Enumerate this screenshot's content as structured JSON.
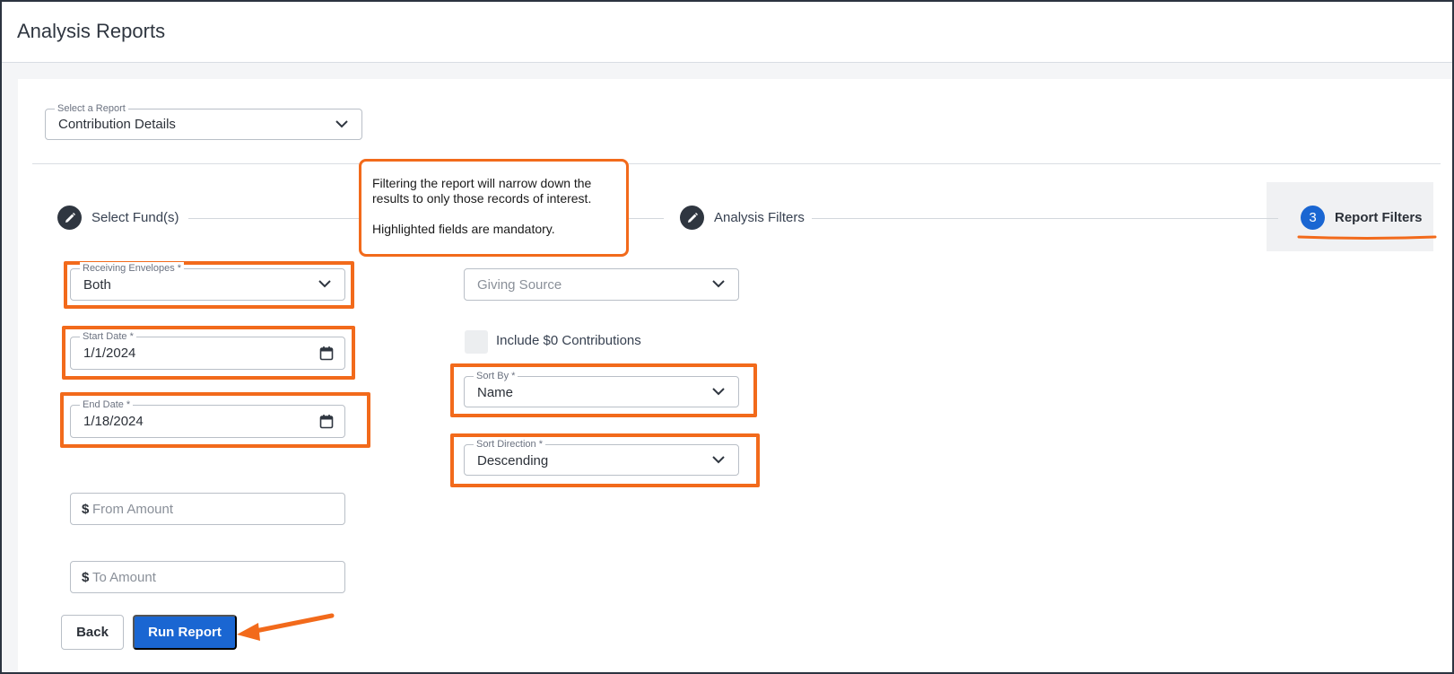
{
  "header": {
    "title": "Analysis Reports"
  },
  "report_select": {
    "label": "Select a Report",
    "value": "Contribution Details"
  },
  "steps": [
    {
      "label": "Select Fund(s)",
      "icon": "pencil-icon"
    },
    {
      "label": "Analysis Filters",
      "icon": "pencil-icon"
    },
    {
      "number": "3",
      "label": "Report Filters"
    }
  ],
  "callout": {
    "line1": "Filtering the report will narrow down the results to only those records of interest.",
    "line2": "Highlighted fields are mandatory."
  },
  "form": {
    "receiving_envelopes": {
      "label": "Receiving Envelopes *",
      "value": "Both"
    },
    "start_date": {
      "label": "Start Date *",
      "value": "1/1/2024"
    },
    "end_date": {
      "label": "End Date *",
      "value": "1/18/2024"
    },
    "from_amount": {
      "prefix": "$",
      "placeholder": "From Amount"
    },
    "to_amount": {
      "prefix": "$",
      "placeholder": "To Amount"
    },
    "giving_source": {
      "placeholder": "Giving Source"
    },
    "include_zero": {
      "label": "Include $0 Contributions",
      "checked": false
    },
    "sort_by": {
      "label": "Sort By *",
      "value": "Name"
    },
    "sort_direction": {
      "label": "Sort Direction *",
      "value": "Descending"
    }
  },
  "buttons": {
    "back": "Back",
    "run": "Run Report"
  },
  "colors": {
    "accent": "#1a66d2",
    "highlight": "#f26a1b",
    "dark": "#2f3640"
  }
}
